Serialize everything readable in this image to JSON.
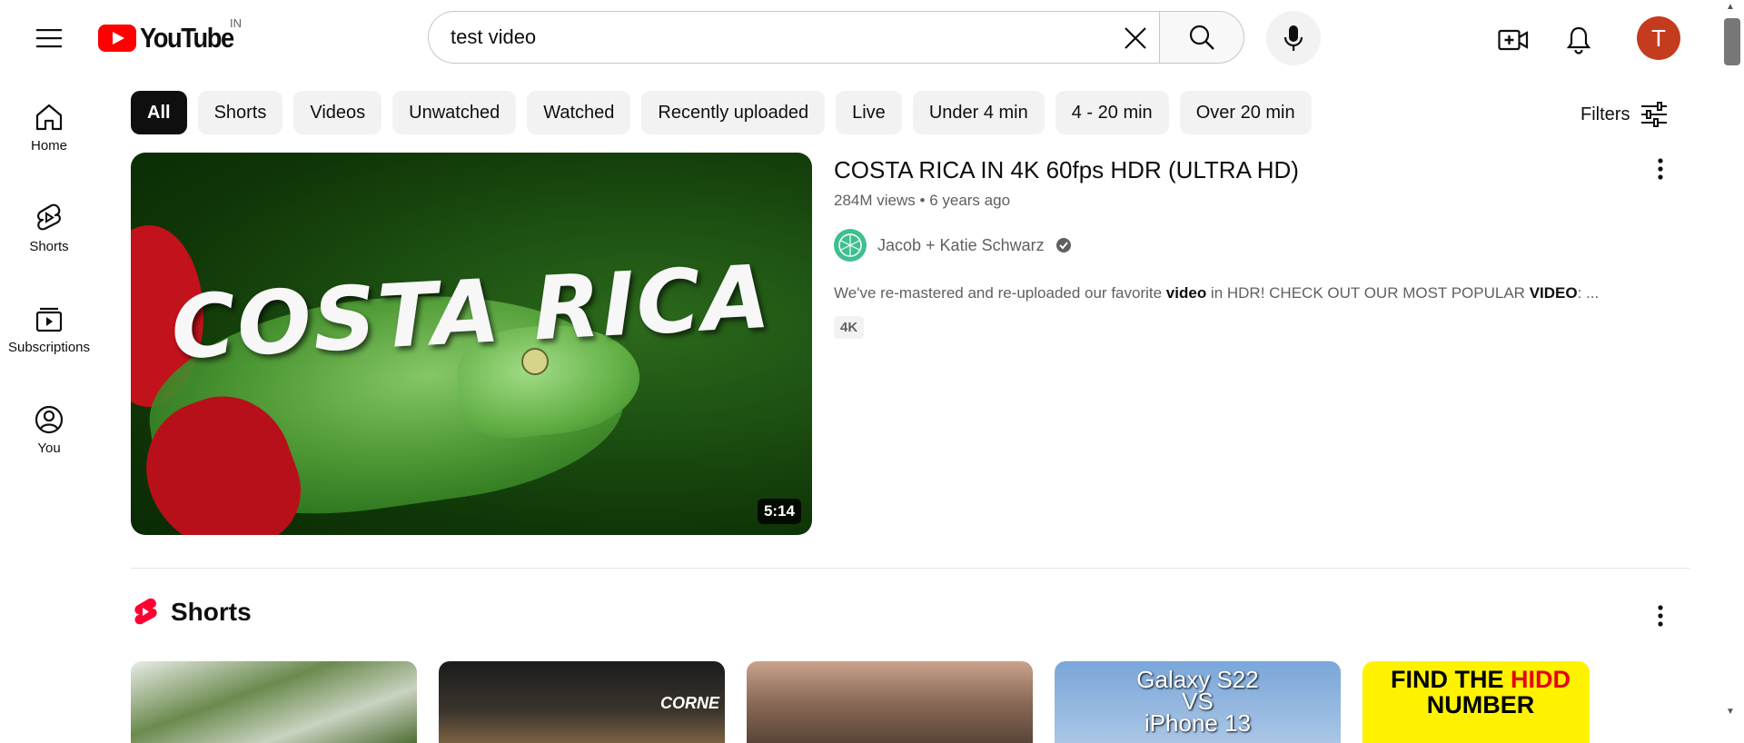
{
  "header": {
    "logo_text": "YouTube",
    "country_code": "IN",
    "search_value": "test video",
    "avatar_letter": "T"
  },
  "sidebar": {
    "items": [
      {
        "label": "Home"
      },
      {
        "label": "Shorts"
      },
      {
        "label": "Subscriptions"
      },
      {
        "label": "You"
      }
    ]
  },
  "chips": [
    "All",
    "Shorts",
    "Videos",
    "Unwatched",
    "Watched",
    "Recently uploaded",
    "Live",
    "Under 4 min",
    "4 - 20 min",
    "Over 20 min"
  ],
  "filters_label": "Filters",
  "video": {
    "thumbnail_text": "COSTA RICA",
    "duration": "5:14",
    "title": "COSTA RICA IN 4K 60fps HDR (ULTRA HD)",
    "views": "284M views",
    "age": "6 years ago",
    "channel": "Jacob + Katie Schwarz",
    "description_parts": [
      {
        "text": "We've re-mastered and re-uploaded our favorite ",
        "bold": false
      },
      {
        "text": "video",
        "bold": true
      },
      {
        "text": " in HDR! CHECK OUT OUR MOST POPULAR ",
        "bold": false
      },
      {
        "text": "VIDEO",
        "bold": true
      },
      {
        "text": ": ...",
        "bold": false
      }
    ],
    "badge": "4K"
  },
  "shorts": {
    "title": "Shorts",
    "items": [
      {
        "text": ""
      },
      {
        "text": "CORNE"
      },
      {
        "text": ""
      },
      {
        "text_line1": "Galaxy S22",
        "text_line2": "VS",
        "text_line3": "iPhone 13"
      },
      {
        "text_line1_a": "FIND THE ",
        "text_line1_b": "HIDD",
        "text_line2": "NUMBER"
      }
    ]
  },
  "colors": {
    "brand_red": "#ff0000",
    "avatar_bg": "#c43b1e",
    "active_chip": "#0f0f0f"
  }
}
